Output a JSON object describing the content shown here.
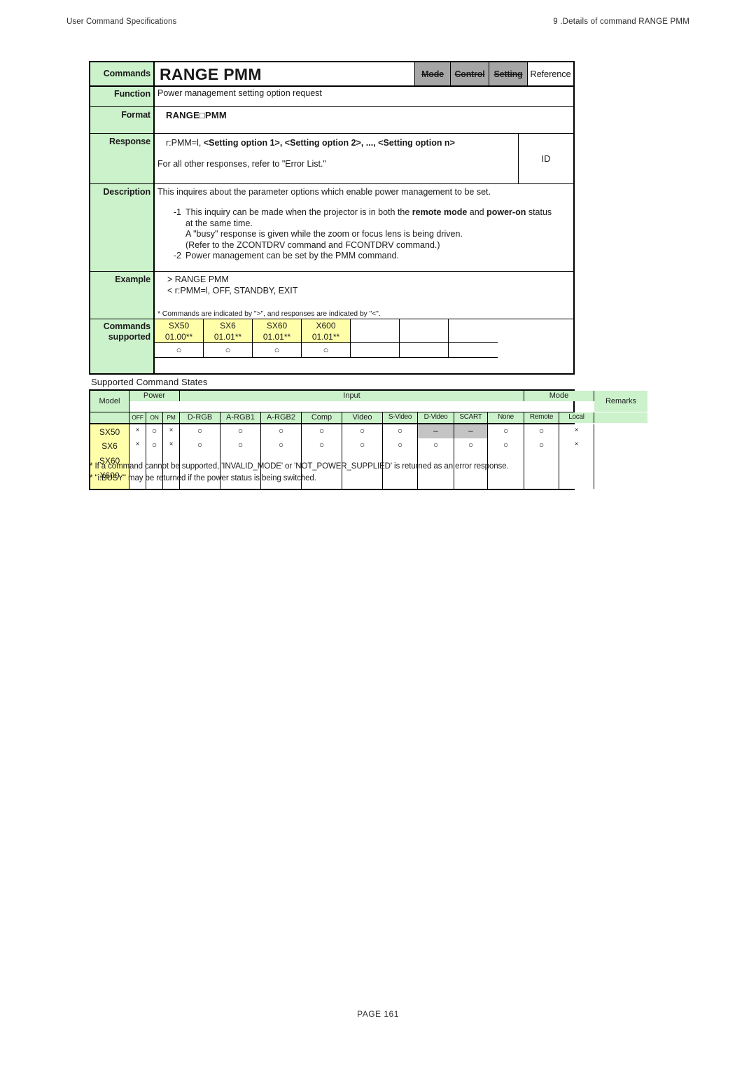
{
  "header": {
    "left": "User Command Specifications",
    "right": "9 .Details of command  RANGE PMM"
  },
  "command": {
    "labels": {
      "commands": "Commands",
      "function": "Function",
      "format": "Format",
      "response": "Response",
      "description": "Description",
      "example": "Example",
      "supported_line1": "Commands",
      "supported_line2": "supported"
    },
    "title": "RANGE PMM",
    "categories": [
      {
        "label": "Mode",
        "active": false
      },
      {
        "label": "Control",
        "active": false
      },
      {
        "label": "Setting",
        "active": false
      },
      {
        "label": "Reference",
        "active": true
      }
    ],
    "function_text": "Power management setting option request",
    "format_text": "RANGE□PMM",
    "response": {
      "line1_prefix": "r:PMM=l, ",
      "line1_bold": "<Setting option 1>, <Setting option 2>, ..., <Setting option n>",
      "line2": "For all other responses, refer to \"Error List.\"",
      "id_label": "ID"
    },
    "description": {
      "intro": "This inquires about the parameter options which enable power management to be set.",
      "items": [
        {
          "num": "-1",
          "lines": [
            "This inquiry can be made when the projector is in both the <b>remote mode</b> and <b>power-on</b> status",
            "at the same time.",
            "A \"busy\" response is given while the zoom or focus lens is being driven.",
            "(Refer to the ZCONTDRV command and FCONTDRV command.)"
          ]
        },
        {
          "num": "-2",
          "lines": [
            "Power management can be set by the PMM command."
          ]
        }
      ]
    },
    "example": {
      "lines": [
        "> RANGE PMM",
        "< r:PMM=l, OFF, STANDBY, EXIT"
      ],
      "note": "* Commands are indicated by \">\", and responses are indicated by \"<\"."
    },
    "supported": {
      "columns": [
        {
          "model": "SX50",
          "version": "01.00**",
          "mark": "○",
          "filled": true
        },
        {
          "model": "SX6",
          "version": "01.01**",
          "mark": "○",
          "filled": true
        },
        {
          "model": "SX60",
          "version": "01.01**",
          "mark": "○",
          "filled": true
        },
        {
          "model": "X600",
          "version": "01.01**",
          "mark": "○",
          "filled": true
        },
        {
          "model": "",
          "version": "",
          "mark": "",
          "filled": false
        },
        {
          "model": "",
          "version": "",
          "mark": "",
          "filled": false
        },
        {
          "model": "",
          "version": "",
          "mark": "",
          "filled": false
        }
      ]
    }
  },
  "states": {
    "title": "Supported Command States",
    "group_headers": {
      "model": "Model",
      "power": "Power",
      "input": "Input",
      "mode": "Mode",
      "remarks": "Remarks"
    },
    "sub_headers": {
      "power": [
        "OFF",
        "ON",
        "PM"
      ],
      "input": [
        "D-RGB",
        "A-RGB1",
        "A-RGB2",
        "Comp",
        "Video",
        "S-Video",
        "D-Video",
        "SCART",
        "None"
      ],
      "mode": [
        "Remote",
        "Local"
      ]
    },
    "rows": [
      {
        "models": [
          "SX50"
        ],
        "marks": [
          "×",
          "○",
          "×",
          "○",
          "○",
          "○",
          "○",
          "○",
          "○",
          "–",
          "–",
          "○",
          "○",
          "×"
        ],
        "dash_flags": [
          false,
          false,
          false,
          false,
          false,
          false,
          false,
          false,
          false,
          true,
          true,
          false,
          false,
          false
        ],
        "remarks": ""
      },
      {
        "models": [
          "SX6",
          "SX60",
          "X600"
        ],
        "marks": [
          "×",
          "○",
          "×",
          "○",
          "○",
          "○",
          "○",
          "○",
          "○",
          "○",
          "○",
          "○",
          "○",
          "×"
        ],
        "dash_flags": [
          false,
          false,
          false,
          false,
          false,
          false,
          false,
          false,
          false,
          false,
          false,
          false,
          false,
          false
        ],
        "remarks": ""
      }
    ],
    "footnotes": [
      "* If a command cannot be supported, 'INVALID_MODE' or 'NOT_POWER_SUPPLIED' is returned as an error response.",
      "* \"i:BUSY\" may be returned if the power status is being switched."
    ]
  },
  "footer": {
    "page": "PAGE 161"
  }
}
